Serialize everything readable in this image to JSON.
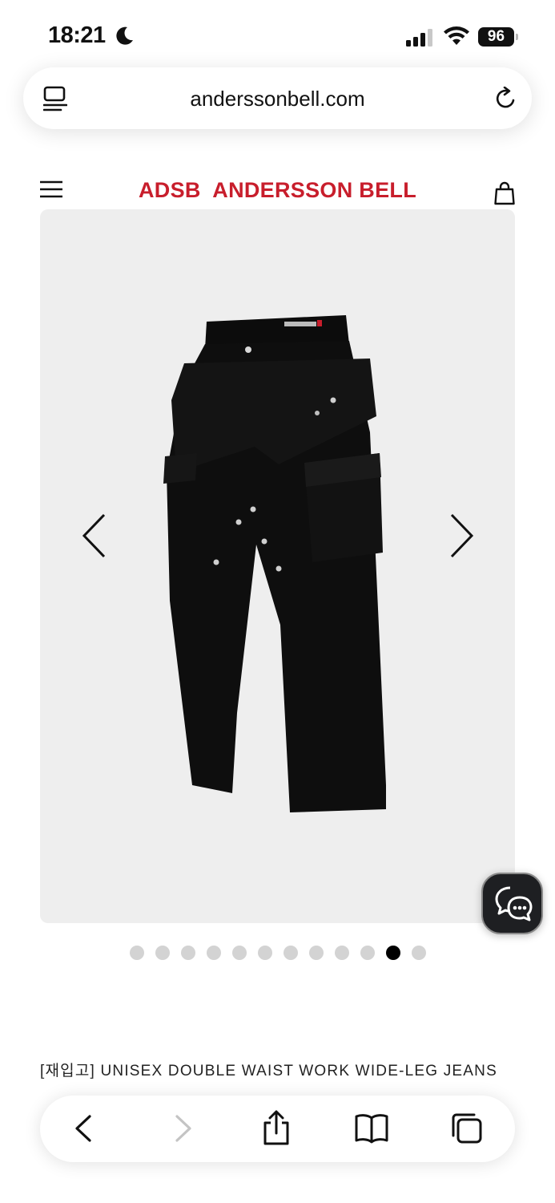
{
  "status_bar": {
    "time": "18:21",
    "battery": "96",
    "icons": [
      "moon-icon",
      "signal-icon",
      "wifi-icon",
      "battery-icon"
    ]
  },
  "browser": {
    "url": "anderssonbell.com",
    "icons": [
      "reader-mode-icon",
      "reload-icon"
    ]
  },
  "site_header": {
    "logo": "ADSB  ANDERSSON BELL",
    "logo_color": "#c81e2c",
    "icons": [
      "hamburger-menu-icon",
      "shopping-bag-icon"
    ]
  },
  "carousel": {
    "slide_count": 12,
    "active_index": 10,
    "image_subject": "black double-waist wide-leg cargo jeans",
    "icons": [
      "chevron-left-icon",
      "chevron-right-icon"
    ]
  },
  "product": {
    "title": "[재입고] UNISEX DOUBLE WAIST WORK WIDE-LEG JEANS"
  },
  "chat_button": {
    "icon": "chat-bubbles-icon"
  },
  "toolbar": {
    "icons": [
      "back-icon",
      "forward-icon",
      "share-icon",
      "bookmarks-icon",
      "tabs-icon"
    ]
  }
}
